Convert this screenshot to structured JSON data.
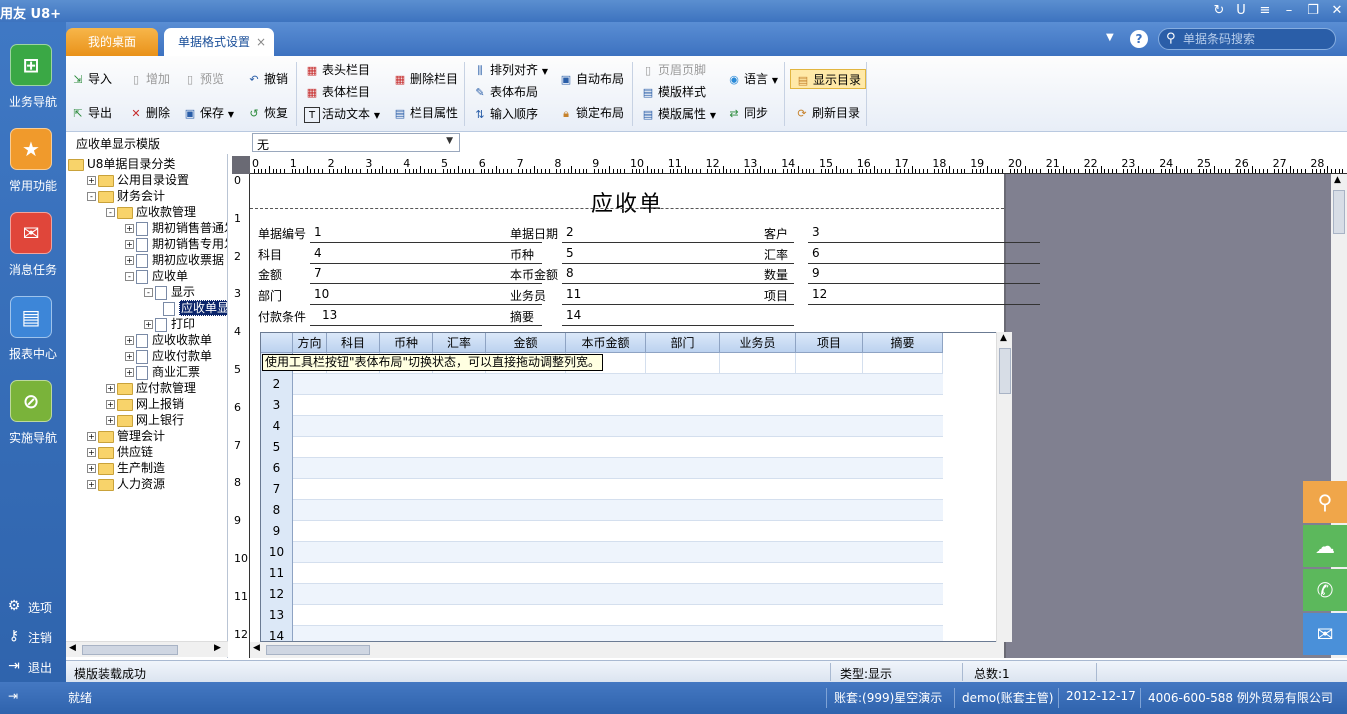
{
  "app": {
    "title": "用友 U8+"
  },
  "tabs": {
    "home": "我的桌面",
    "active": "单据格式设置",
    "close": "×"
  },
  "search": {
    "placeholder": "单据条码搜索"
  },
  "leftnav": {
    "items": [
      {
        "label": "业务导航",
        "icon": "business-nav-icon"
      },
      {
        "label": "常用功能",
        "icon": "star-icon"
      },
      {
        "label": "消息任务",
        "icon": "mail-icon"
      },
      {
        "label": "报表中心",
        "icon": "report-icon"
      },
      {
        "label": "实施导航",
        "icon": "compass-icon"
      }
    ],
    "bottom": [
      {
        "label": "选项",
        "icon": "gear-icon"
      },
      {
        "label": "注销",
        "icon": "key-icon"
      },
      {
        "label": "退出",
        "icon": "exit-icon"
      }
    ]
  },
  "toolbar": {
    "import": "导入",
    "export": "导出",
    "add": "增加",
    "preview": "预览",
    "delete": "删除",
    "save": "保存",
    "undo": "撤销",
    "restore": "恢复",
    "header_col": "表头栏目",
    "body_col": "表体栏目",
    "active_text": "活动文本",
    "delete_col": "删除栏目",
    "col_props": "栏目属性",
    "align": "排列对齐",
    "body_layout": "表体布局",
    "input_order": "输入顺序",
    "auto_layout": "自动布局",
    "lock_layout": "锁定布局",
    "header_footer": "页眉页脚",
    "template_style": "模版样式",
    "template_props": "模版属性",
    "language": "语言",
    "sync": "同步",
    "show_dir": "显示目录",
    "refresh_dir": "刷新目录"
  },
  "template": {
    "label": "应收单显示模版",
    "value": "无"
  },
  "tree": [
    {
      "label": "U8单据目录分类",
      "level": 0,
      "exp": "",
      "icon": "fold"
    },
    {
      "label": "公用目录设置",
      "level": 1,
      "exp": "+",
      "icon": "fold"
    },
    {
      "label": "财务会计",
      "level": 1,
      "exp": "-",
      "icon": "fold"
    },
    {
      "label": "应收款管理",
      "level": 2,
      "exp": "-",
      "icon": "fold"
    },
    {
      "label": "期初销售普通发票",
      "level": 3,
      "exp": "+",
      "icon": "doc"
    },
    {
      "label": "期初销售专用发票",
      "level": 3,
      "exp": "+",
      "icon": "doc"
    },
    {
      "label": "期初应收票据",
      "level": 3,
      "exp": "+",
      "icon": "doc"
    },
    {
      "label": "应收单",
      "level": 3,
      "exp": "-",
      "icon": "doc"
    },
    {
      "label": "显示",
      "level": 4,
      "exp": "-",
      "icon": "doc"
    },
    {
      "label": "应收单显示模版",
      "level": 5,
      "exp": "",
      "icon": "doc",
      "selected": true
    },
    {
      "label": "打印",
      "level": 4,
      "exp": "+",
      "icon": "doc"
    },
    {
      "label": "应收收款单",
      "level": 3,
      "exp": "+",
      "icon": "doc"
    },
    {
      "label": "应收付款单",
      "level": 3,
      "exp": "+",
      "icon": "doc"
    },
    {
      "label": "商业汇票",
      "level": 3,
      "exp": "+",
      "icon": "doc"
    },
    {
      "label": "应付款管理",
      "level": 2,
      "exp": "+",
      "icon": "fold"
    },
    {
      "label": "网上报销",
      "level": 2,
      "exp": "+",
      "icon": "fold"
    },
    {
      "label": "网上银行",
      "level": 2,
      "exp": "+",
      "icon": "fold"
    },
    {
      "label": "管理会计",
      "level": 1,
      "exp": "+",
      "icon": "fold"
    },
    {
      "label": "供应链",
      "level": 1,
      "exp": "+",
      "icon": "fold"
    },
    {
      "label": "生产制造",
      "level": 1,
      "exp": "+",
      "icon": "fold"
    },
    {
      "label": "人力资源",
      "level": 1,
      "exp": "+",
      "icon": "fold"
    }
  ],
  "ruler": {
    "top": [
      "0",
      "1",
      "2",
      "3",
      "4",
      "5",
      "6",
      "7",
      "8",
      "9",
      "10",
      "11",
      "12",
      "13",
      "14",
      "15",
      "16",
      "17",
      "18",
      "19",
      "20",
      "21",
      "22",
      "23",
      "24",
      "25",
      "26",
      "27",
      "28"
    ],
    "left": [
      "0",
      "1",
      "2",
      "3",
      "4",
      "5",
      "6",
      "7",
      "8",
      "9",
      "10",
      "11",
      "12"
    ]
  },
  "document": {
    "title": "应收单",
    "fields": [
      {
        "label": "单据编号",
        "value": "1"
      },
      {
        "label": "单据日期",
        "value": "2"
      },
      {
        "label": "客户",
        "value": "3"
      },
      {
        "label": "科目",
        "value": "4"
      },
      {
        "label": "币种",
        "value": "5"
      },
      {
        "label": "汇率",
        "value": "6"
      },
      {
        "label": "金额",
        "value": "7"
      },
      {
        "label": "本币金额",
        "value": "8"
      },
      {
        "label": "数量",
        "value": "9"
      },
      {
        "label": "部门",
        "value": "10"
      },
      {
        "label": "业务员",
        "value": "11"
      },
      {
        "label": "项目",
        "value": "12"
      },
      {
        "label": "付款条件",
        "value": "13"
      },
      {
        "label": "摘要",
        "value": "14"
      }
    ],
    "columns": [
      "方向",
      "科目",
      "币种",
      "汇率",
      "金额",
      "本币金额",
      "部门",
      "业务员",
      "项目",
      "摘要"
    ],
    "rows": [
      "2",
      "3",
      "4",
      "5",
      "6",
      "7",
      "8",
      "9",
      "10",
      "11",
      "12",
      "13",
      "14"
    ],
    "hint": "使用工具栏按钮\"表体布局\"切换状态，可以直接拖动调整列宽。"
  },
  "status": {
    "message": "模版装载成功",
    "type": "类型:显示",
    "total": "总数:1"
  },
  "footer": {
    "ready": "就绪",
    "account": "账套:(999)星空演示",
    "user": "demo(账套主管)",
    "date": "2012-12-17",
    "company": "4006-600-588 例外贸易有限公司"
  },
  "colors": {
    "accent": "#3d72c0",
    "tab_home": "#f0a030",
    "float_orange": "#f0a64a",
    "float_green": "#5cb85c",
    "float_blue": "#4a90d9"
  }
}
